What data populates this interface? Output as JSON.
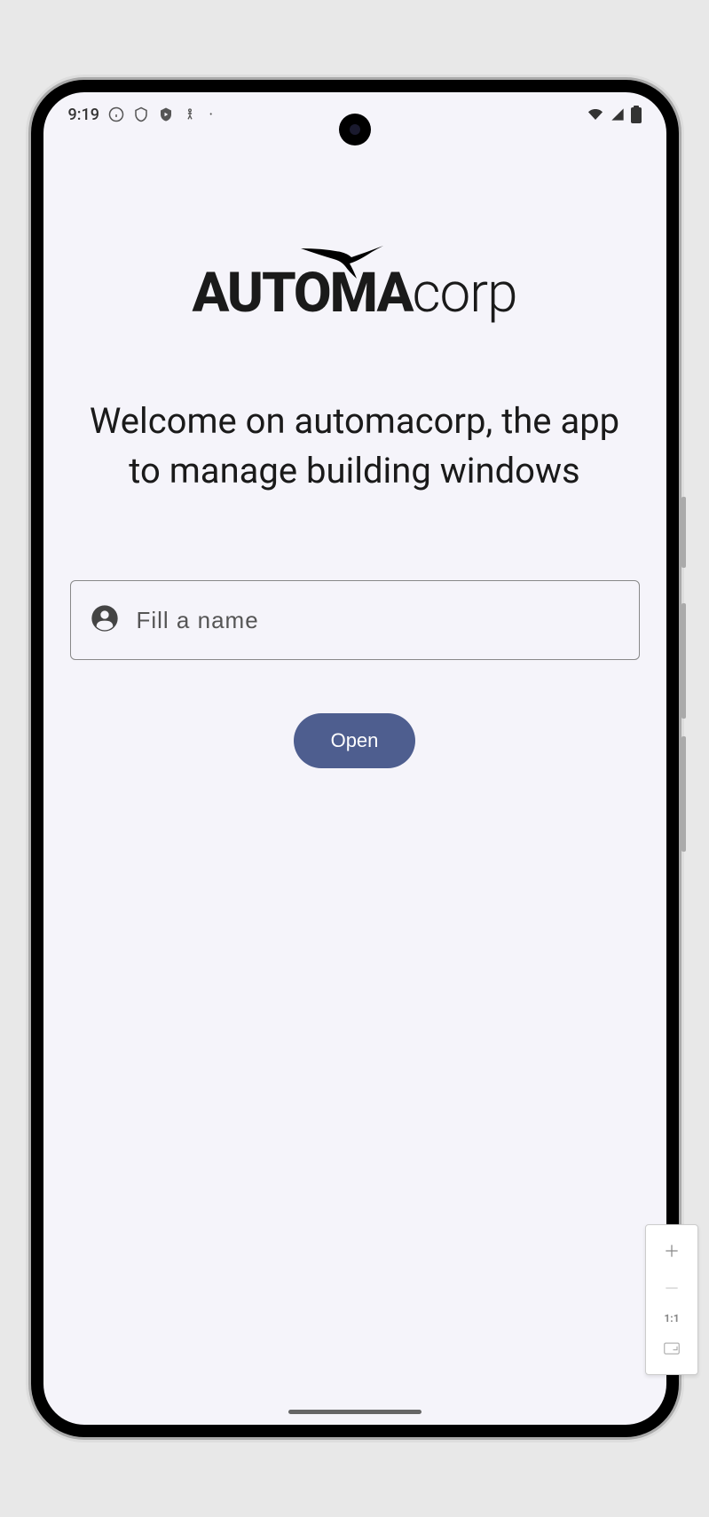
{
  "status": {
    "time": "9:19"
  },
  "logo": {
    "bold": "AUTOMA",
    "light": "corp"
  },
  "welcome": "Welcome on automacorp, the app to manage building windows",
  "input": {
    "placeholder": "Fill a name",
    "value": ""
  },
  "button": {
    "open": "Open"
  },
  "zoom": {
    "label": "1:1"
  }
}
